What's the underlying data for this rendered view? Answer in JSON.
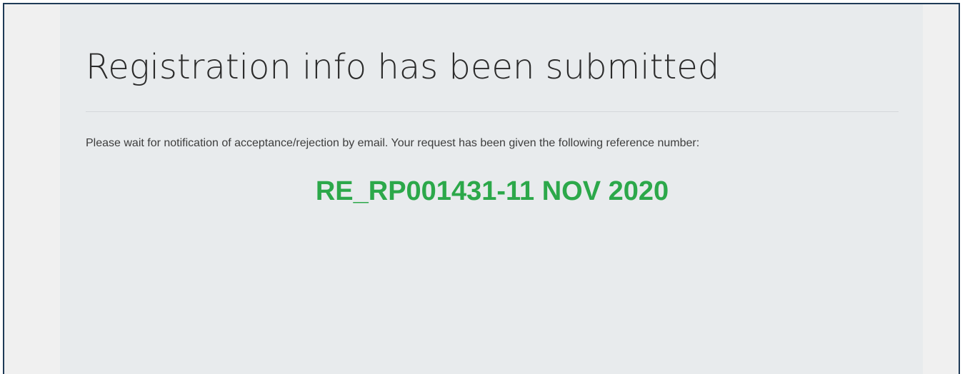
{
  "page": {
    "title": "Registration info has been submitted",
    "message": "Please wait for notification of acceptance/rejection by email. Your request has been given the following reference number:",
    "reference_number": "RE_RP001431-11 NOV 2020"
  },
  "colors": {
    "reference_number": "#2ca84a",
    "panel_background": "#e8ebed",
    "page_background": "#f0f0f0",
    "frame_border": "#1f3b57"
  }
}
